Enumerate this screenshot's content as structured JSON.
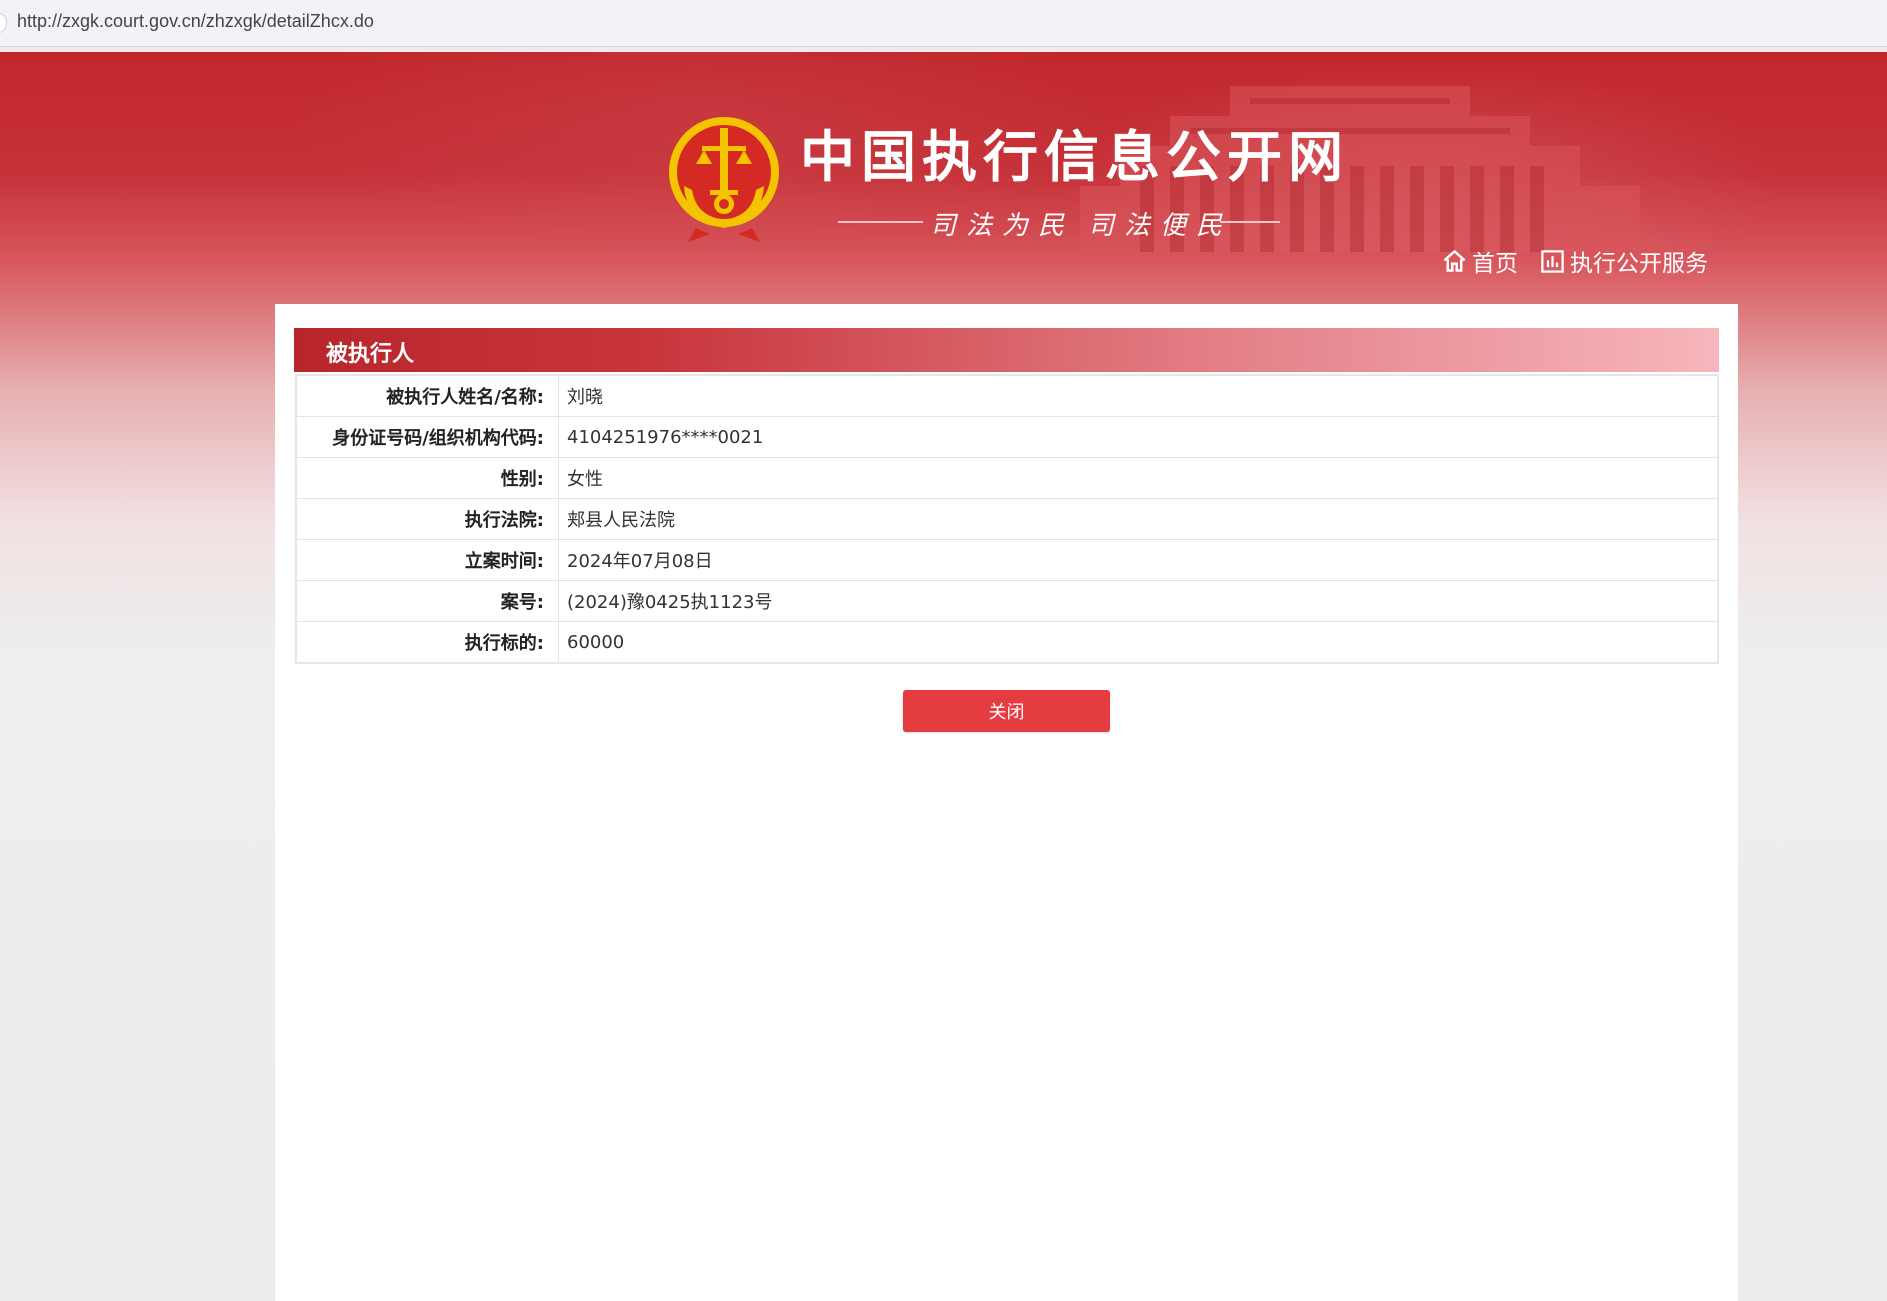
{
  "browser": {
    "url": "http://zxgk.court.gov.cn/zhzxgk/detailZhcx.do"
  },
  "header": {
    "site_title": "中国执行信息公开网",
    "slogan_left": "司法为民",
    "slogan_right": "司法便民",
    "nav": [
      {
        "label": "首页",
        "icon": "home-icon"
      },
      {
        "label": "执行公开服务",
        "icon": "chart-icon"
      }
    ]
  },
  "section": {
    "title": "被执行人"
  },
  "rows": [
    {
      "label": "被执行人姓名/名称:",
      "value": "刘晓"
    },
    {
      "label": "身份证号码/组织机构代码:",
      "value": "4104251976****0021"
    },
    {
      "label": "性别:",
      "value": "女性"
    },
    {
      "label": "执行法院:",
      "value": "郏县人民法院"
    },
    {
      "label": "立案时间:",
      "value": "2024年07月08日"
    },
    {
      "label": "案号:",
      "value": "(2024)豫0425执1123号"
    },
    {
      "label": "执行标的:",
      "value": "60000"
    }
  ],
  "close_button": {
    "label": "关闭"
  },
  "colors": {
    "brand_red": "#c1262c",
    "button_red": "#e53c42",
    "emblem_gold": "#f5c400"
  }
}
